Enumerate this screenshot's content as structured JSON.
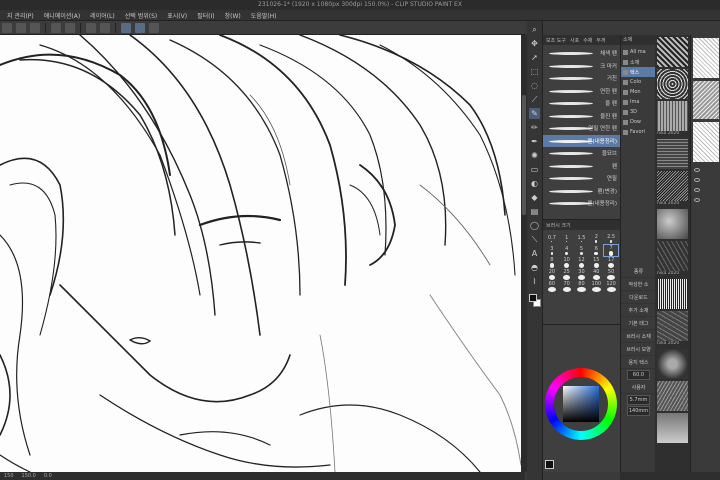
{
  "window": {
    "title": "231026-1* (1920 x 1080px 300dpi 150.0%) - CLIP STUDIO PAINT EX"
  },
  "menu": [
    "지 관리(P)",
    "애니메이션(A)",
    "레이어(L)",
    "선택 범위(S)",
    "표시(V)",
    "필터(I)",
    "창(W)",
    "도움말(H)"
  ],
  "brush_panel": {
    "header": [
      "보조 도구",
      "사포",
      "수채",
      "두꺼"
    ],
    "items": [
      {
        "label": "채색 펜"
      },
      {
        "label": "크 마커"
      },
      {
        "label": "거친"
      },
      {
        "label": "연한 펜"
      },
      {
        "label": "울 펜"
      },
      {
        "label": "울진 펜"
      },
      {
        "label": "연필 연한 펜"
      },
      {
        "label": "펜(내용정리)",
        "selected": true
      },
      {
        "label": "울묘브"
      },
      {
        "label": "펜"
      },
      {
        "label": "연필"
      },
      {
        "label": "펜(변경)"
      },
      {
        "label": "펜(내용정리)"
      }
    ]
  },
  "brush_size": {
    "header": "브러시 크기",
    "rows": [
      [
        "0.7",
        "1",
        "1.5",
        "2",
        "2.5"
      ],
      [
        "3",
        "4",
        "5",
        "6",
        "7"
      ],
      [
        "8",
        "10",
        "12",
        "15",
        "17"
      ],
      [
        "20",
        "25",
        "30",
        "40",
        "50"
      ],
      [
        "60",
        "70",
        "80",
        "100",
        "120"
      ]
    ],
    "selected": "7"
  },
  "sub_column": {
    "header": "소재",
    "tree": [
      {
        "label": "All ma"
      },
      {
        "label": "소재"
      },
      {
        "label": "텍스",
        "selected": true
      },
      {
        "label": "Colo"
      },
      {
        "label": "Mon"
      },
      {
        "label": "Ima"
      },
      {
        "label": "3D"
      },
      {
        "label": "Dow"
      },
      {
        "label": "Favori"
      }
    ],
    "props": [
      {
        "label": "종류"
      },
      {
        "label": "작성한 소"
      },
      {
        "label": "다운로드"
      },
      {
        "label": "추가 소재"
      },
      {
        "label": "기본 태그"
      },
      {
        "label": "브러시 소재"
      },
      {
        "label": "브러시 모양"
      },
      {
        "label": "용지 텍스"
      },
      {
        "label": "60.0",
        "box": true
      },
      {
        "label": "사용자"
      },
      {
        "label": "5.7mm",
        "box": true
      },
      {
        "label": "140mm",
        "box": true
      }
    ]
  },
  "textures": {
    "labels": [
      "nika 2020",
      "nika 2020",
      "nika 2020",
      "nika 2020"
    ]
  },
  "status": {
    "left": "150",
    "zoom": "150.0",
    "angle": "0.0"
  }
}
